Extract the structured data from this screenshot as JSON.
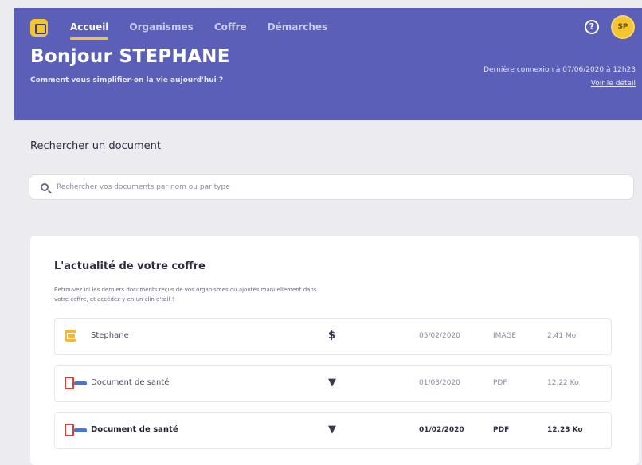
{
  "header": {
    "nav": [
      "Accueil",
      "Organismes",
      "Coffre",
      "Démarches"
    ],
    "greeting": "Bonjour STEPHANE",
    "subgreeting": "Comment vous simplifier-on la vie aujourd'hui ?",
    "last_login": "Dernière connexion à 07/06/2020 à 12h23",
    "last_login_link": "Voir le détail",
    "help_icon": "?",
    "avatar_initials": "SP"
  },
  "search": {
    "title": "Rechercher un document",
    "placeholder": "Rechercher vos documents par nom ou par type"
  },
  "news": {
    "title": "L'actualité de votre coffre",
    "description": "Retrouvez ici les derniers documents reçus de vos organismes ou ajoutés manuellement dans votre coffre, et accédez-y en un clin d'œil !",
    "rows": [
      {
        "icon": "image-icon",
        "name": "Stephane",
        "owner": "$",
        "date": "05/02/2020",
        "type": "IMAGE",
        "size": "2,41 Mo"
      },
      {
        "icon": "pdf-icon",
        "name": "Document de santé",
        "owner": "▼",
        "date": "01/03/2020",
        "type": "PDF",
        "size": "12,22 Ko"
      },
      {
        "icon": "pdf-icon",
        "name": "Document de santé",
        "owner": "▼",
        "date": "01/02/2020",
        "type": "PDF",
        "size": "12,23 Ko"
      }
    ]
  },
  "colors": {
    "primary": "#5b5fb8",
    "accent": "#f4c431"
  }
}
